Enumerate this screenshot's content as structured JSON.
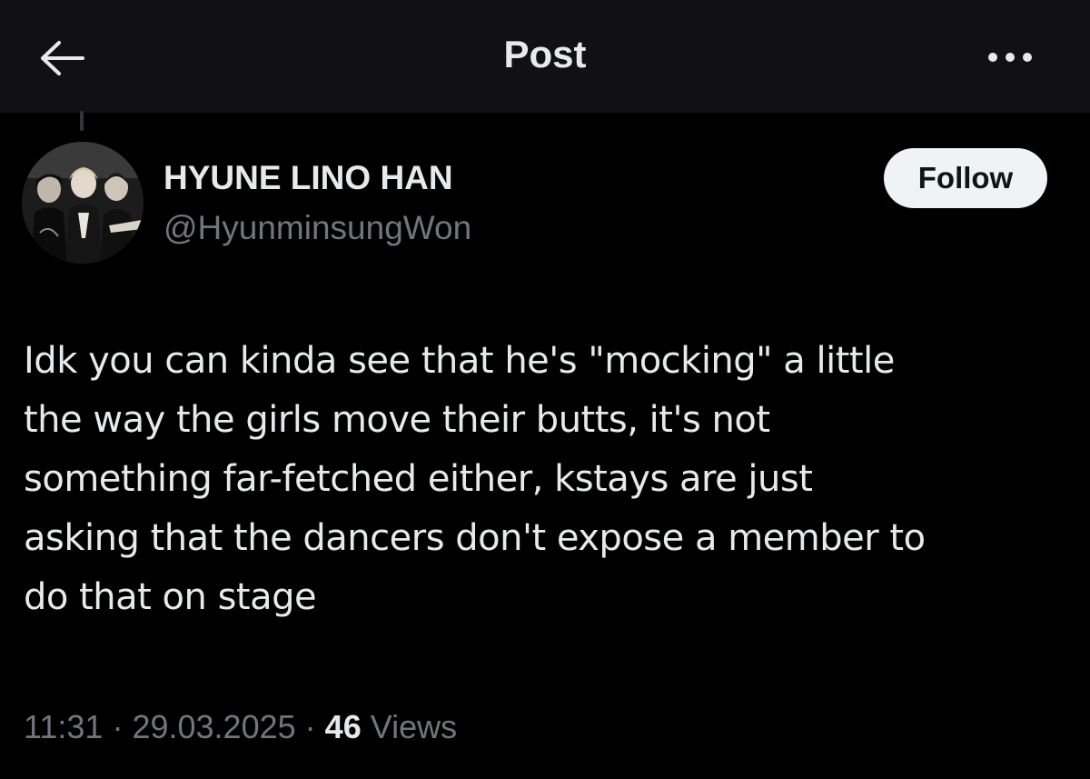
{
  "header": {
    "title": "Post",
    "back_icon": "arrow-left-icon",
    "more_icon": "more-horizontal-icon"
  },
  "author": {
    "display_name": "HYUNE LINO HAN",
    "handle": "@HyunminsungWon",
    "follow_label": "Follow"
  },
  "post": {
    "lines": [
      "Idk you can kinda see that he's \"mocking\" a little",
      "the way the girls move their butts, it's not",
      "something far-fetched either, kstays are just",
      "asking that the dancers don't expose a member to",
      "do that on stage"
    ]
  },
  "meta": {
    "time": "11:31",
    "separator": "·",
    "date": "29.03.2025",
    "views_count": "46",
    "views_label": "Views"
  },
  "colors": {
    "background": "#000000",
    "header_background": "#111113",
    "primary_text": "#e7e9ea",
    "secondary_text": "#71767b",
    "button_background": "#eff3f4",
    "button_text": "#0f1419"
  }
}
